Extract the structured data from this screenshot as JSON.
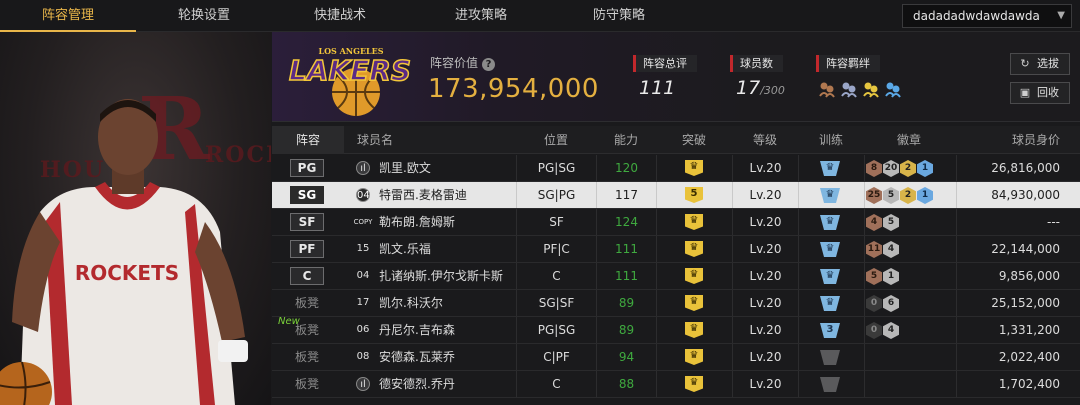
{
  "tabs": [
    "阵容管理",
    "轮换设置",
    "快捷战术",
    "进攻策略",
    "防守策略"
  ],
  "team_selector": {
    "value": "dadadadwdawdawda"
  },
  "left_panel": {
    "bg_text_left": "HOU",
    "bg_text_right": "ROCKETS",
    "jersey_text": "ROCKETS"
  },
  "header": {
    "team_logo_text": "LAKERS",
    "team_logo_top": "LOS ANGELES",
    "value_label": "阵容价值",
    "value": "173,954,000",
    "rating_label": "阵容总评",
    "rating": "111",
    "count_label": "球员数",
    "count": "17",
    "count_max": "/300",
    "bond_label": "阵容羁绊",
    "btn_select": "选拔",
    "btn_recycle": "回收"
  },
  "columns": [
    "阵容",
    "球员名",
    "位置",
    "能力",
    "突破",
    "等级",
    "训练",
    "徽章",
    "球员身价"
  ],
  "rows": [
    {
      "slot": "PG",
      "num": "",
      "num_icon": "bars",
      "name": "凯里.欧文",
      "position": "PG|SG",
      "ability": "120",
      "breakthrough": "",
      "level": "Lv.20",
      "train": "",
      "badges": [
        [
          "b",
          "8"
        ],
        [
          "s",
          "20"
        ],
        [
          "g",
          "2"
        ],
        [
          "bl",
          "1"
        ]
      ],
      "price": "26,816,000"
    },
    {
      "slot": "SG",
      "num": "04",
      "num_icon": "circle",
      "name": "特雷西.麦格雷迪",
      "position": "SG|PG",
      "ability": "117",
      "breakthrough": "5",
      "level": "Lv.20",
      "train": "",
      "badges": [
        [
          "b",
          "25"
        ],
        [
          "s",
          "5"
        ],
        [
          "g",
          "2"
        ],
        [
          "bl",
          "1"
        ]
      ],
      "price": "84,930,000",
      "selected": true
    },
    {
      "slot": "SF",
      "num": "COPY",
      "num_icon": "copy",
      "name": "勒布朗.詹姆斯",
      "position": "SF",
      "ability": "124",
      "breakthrough": "",
      "level": "Lv.20",
      "train": "",
      "badges": [
        [
          "b",
          "4"
        ],
        [
          "s",
          "5"
        ]
      ],
      "price": "---"
    },
    {
      "slot": "PF",
      "num": "15",
      "num_icon": "text",
      "name": "凯文.乐福",
      "position": "PF|C",
      "ability": "111",
      "breakthrough": "",
      "level": "Lv.20",
      "train": "",
      "badges": [
        [
          "b",
          "11"
        ],
        [
          "s",
          "4"
        ]
      ],
      "price": "22,144,000"
    },
    {
      "slot": "C",
      "num": "04",
      "num_icon": "text",
      "name": "扎诸纳斯.伊尔戈斯卡斯",
      "position": "C",
      "ability": "111",
      "breakthrough": "",
      "level": "Lv.20",
      "train": "",
      "badges": [
        [
          "b",
          "5"
        ],
        [
          "s",
          "1"
        ]
      ],
      "price": "9,856,000"
    },
    {
      "slot": "板凳",
      "num": "17",
      "num_icon": "text",
      "name": "凯尔.科沃尔",
      "position": "SG|SF",
      "ability": "89",
      "breakthrough": "",
      "level": "Lv.20",
      "train": "",
      "badges": [
        [
          "d",
          "0"
        ],
        [
          "s",
          "6"
        ]
      ],
      "price": "25,152,000"
    },
    {
      "slot": "板凳",
      "num": "06",
      "num_icon": "text",
      "name": "丹尼尔.吉布森",
      "position": "PG|SG",
      "ability": "89",
      "breakthrough": "",
      "level": "Lv.20",
      "train": "3",
      "badges": [
        [
          "d",
          "0"
        ],
        [
          "s",
          "4"
        ]
      ],
      "price": "1,331,200",
      "new": "New"
    },
    {
      "slot": "板凳",
      "num": "08",
      "num_icon": "text",
      "name": "安德森.瓦莱乔",
      "position": "C|PF",
      "ability": "94",
      "breakthrough": "",
      "level": "Lv.20",
      "train": "grey",
      "badges": [],
      "price": "2,022,400"
    },
    {
      "slot": "板凳",
      "num": "",
      "num_icon": "bars",
      "name": "德安德烈.乔丹",
      "position": "C",
      "ability": "88",
      "breakthrough": "",
      "level": "Lv.20",
      "train": "grey",
      "badges": [],
      "price": "1,702,400"
    }
  ],
  "colors": {
    "accent": "#e9b64a",
    "value_gold": "#e4b040",
    "ability_green": "#3fa93f",
    "stat_red": "#c2282c"
  }
}
